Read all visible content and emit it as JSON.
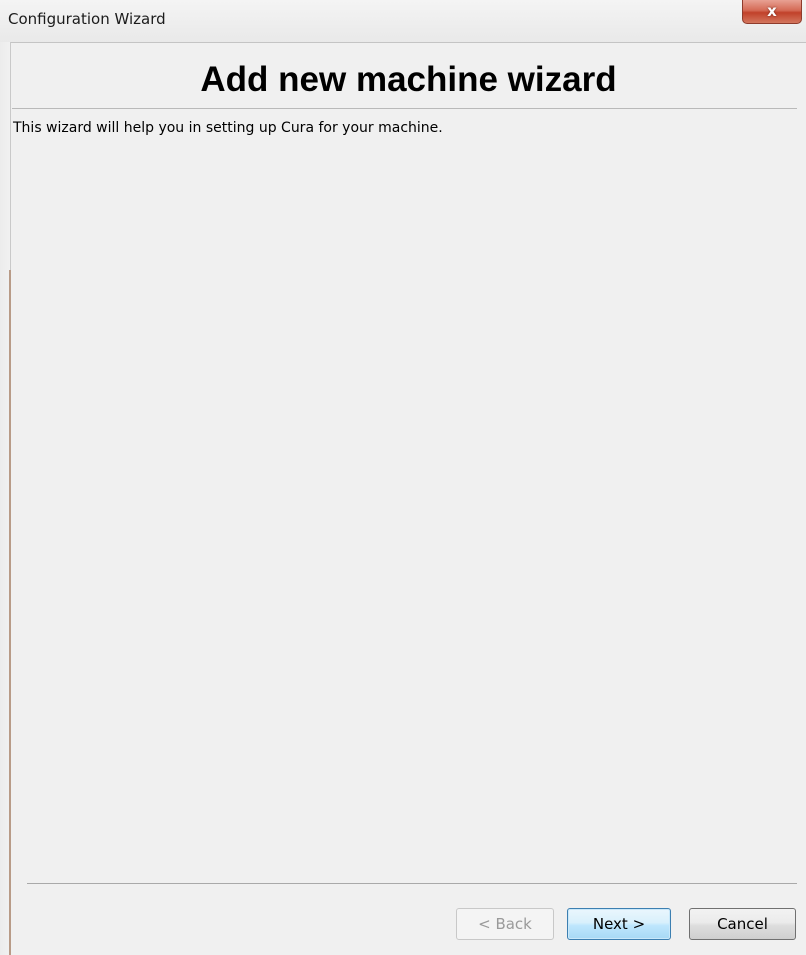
{
  "window": {
    "title": "Configuration Wizard",
    "close_label": "x"
  },
  "wizard": {
    "heading": "Add new machine wizard",
    "description": "This wizard will help you in setting up Cura for your machine."
  },
  "buttons": {
    "back": "< Back",
    "next": "Next >",
    "cancel": "Cancel"
  },
  "states": {
    "back_enabled": false,
    "next_default": true
  }
}
